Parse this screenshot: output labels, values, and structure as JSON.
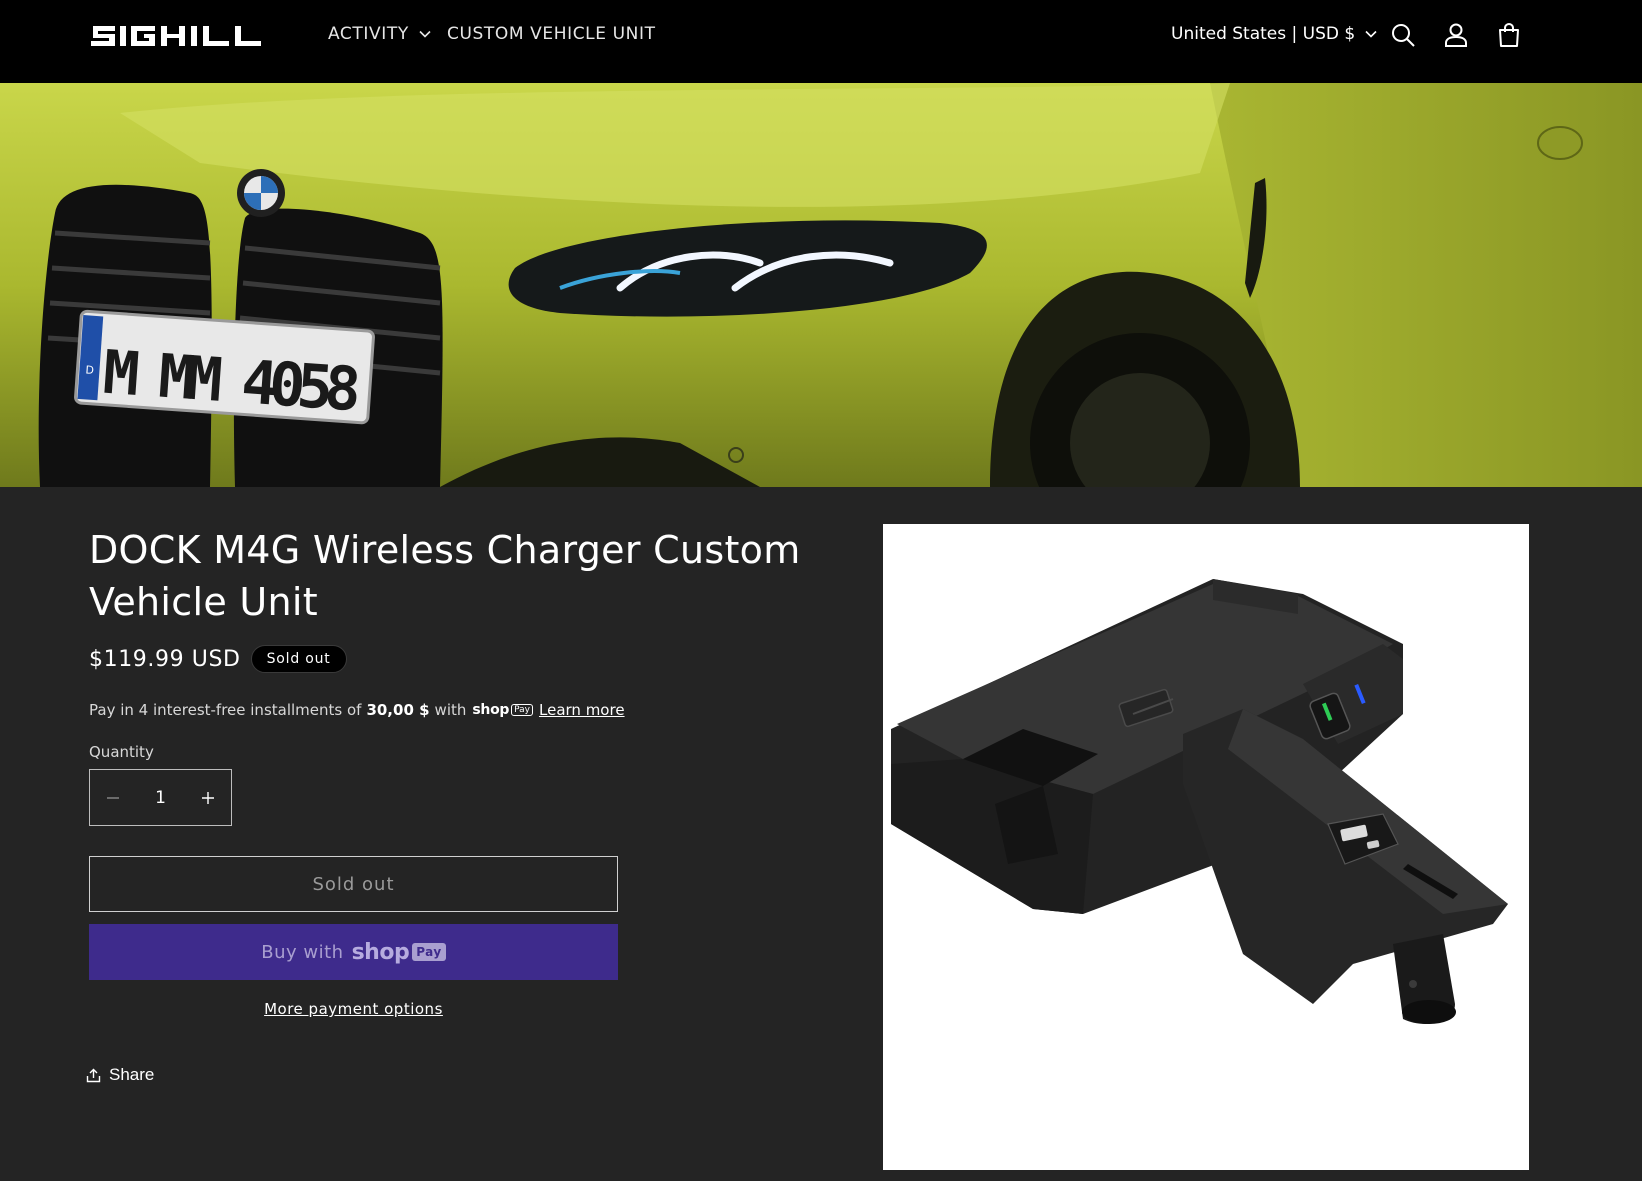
{
  "header": {
    "logo_text": "SIGHILL",
    "nav": [
      {
        "label": "ACTIVITY",
        "has_dropdown": true
      },
      {
        "label": "CUSTOM VEHICLE UNIT",
        "has_dropdown": false
      }
    ],
    "currency": "United States | USD $",
    "icons": [
      "search-icon",
      "account-icon",
      "cart-icon"
    ]
  },
  "hero": {
    "plate_text": "M MM 4058",
    "plate_country": "D"
  },
  "product": {
    "title": "DOCK M4G Wireless Charger Custom Vehicle Unit",
    "price": "$119.99 USD",
    "badge": "Sold out",
    "installments_prefix": "Pay in 4 interest-free installments of",
    "installments_amount": "30,00 $",
    "installments_with": "with",
    "shoppay_word": "shop",
    "shoppay_pay": "Pay",
    "learn_more": "Learn more",
    "quantity_label": "Quantity",
    "quantity_value": "1",
    "soldout_button": "Sold out",
    "buy_with": "Buy with",
    "buy_shop": "shop",
    "buy_pay": "Pay",
    "more_payment": "More payment options",
    "share": "Share"
  },
  "colors": {
    "header_bg": "#000000",
    "page_bg": "#242424",
    "shoppay_purple": "#3e2b8c",
    "car_yellow_green": "#b8c93a"
  }
}
